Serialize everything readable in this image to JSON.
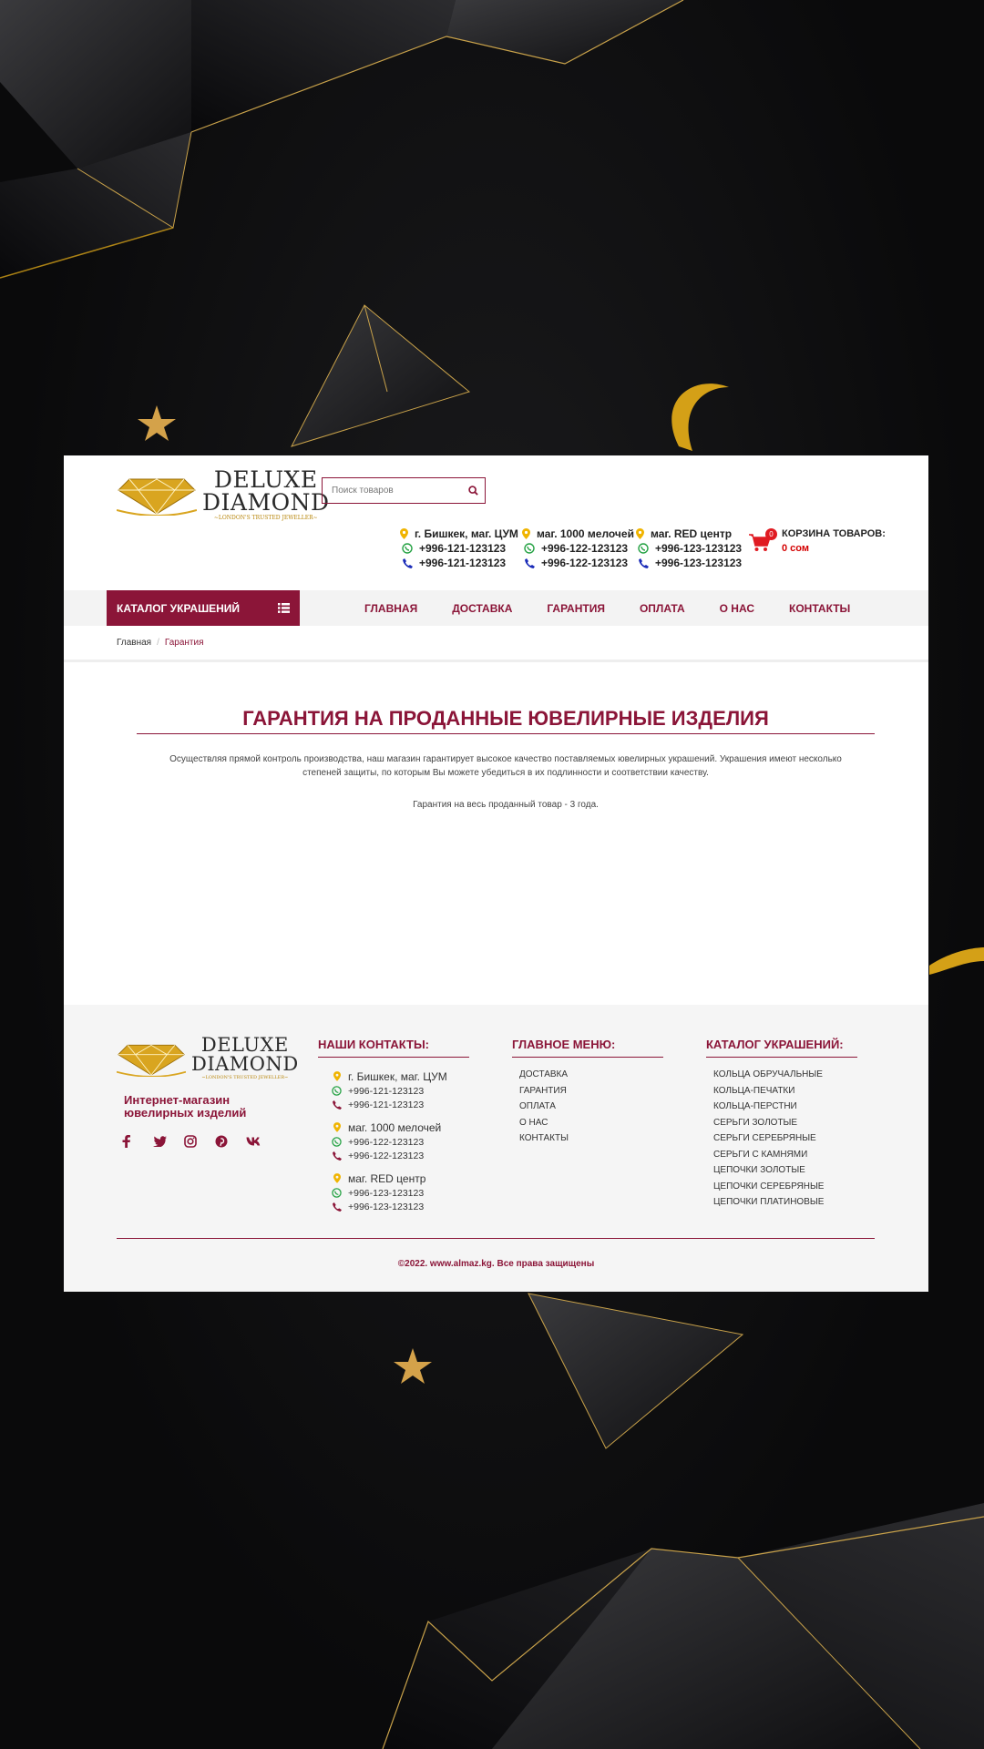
{
  "brand": {
    "name_line1": "DELUXE",
    "name_line2": "DIAMOND",
    "tagline": "~LONDON'S TRUSTED JEWELLER~",
    "gold": "#d4a017",
    "accent": "#8b1538"
  },
  "search": {
    "placeholder": "Поиск товаров",
    "icon": "search-icon"
  },
  "stores": [
    {
      "name": "г. Бишкек, маг. ЦУМ",
      "whatsapp": "+996-121-123123",
      "phone": "+996-121-123123"
    },
    {
      "name": "маг. 1000 мелочей",
      "whatsapp": "+996-122-123123",
      "phone": "+996-122-123123"
    },
    {
      "name": "маг. RED центр",
      "whatsapp": "+996-123-123123",
      "phone": "+996-123-123123"
    }
  ],
  "cart": {
    "count": "0",
    "title": "КОРЗИНА ТОВАРОВ:",
    "sum": "0 сом"
  },
  "nav": {
    "catalog_label": "КАТАЛОГ УКРАШЕНИЙ",
    "links": [
      "ГЛАВНАЯ",
      "ДОСТАВКА",
      "ГАРАНТИЯ",
      "ОПЛАТА",
      "О НАС",
      "КОНТАКТЫ"
    ]
  },
  "breadcrumb": {
    "home": "Главная",
    "current": "Гарантия"
  },
  "content": {
    "title": "ГАРАНТИЯ НА ПРОДАННЫЕ ЮВЕЛИРНЫЕ ИЗДЕЛИЯ",
    "intro": "Осуществляя прямой контроль производства, наш магазин гарантирует высокое качество поставляемых ювелирных украшений. Украшения имеют несколько степеней защиты, по которым Вы можете убедиться в их подлинности и соответствии качеству.",
    "guarantee": "Гарантия на весь проданный товар - 3 года."
  },
  "footer": {
    "tagline": "Интернет-магазин ювелирных изделий",
    "socials": [
      "facebook-icon",
      "twitter-icon",
      "instagram-icon",
      "pinterest-icon",
      "vk-icon"
    ],
    "contacts_title": "НАШИ КОНТАКТЫ:",
    "menu_title": "ГЛАВНОЕ МЕНЮ:",
    "menu": [
      "ДОСТАВКА",
      "ГАРАНТИЯ",
      "ОПЛАТА",
      "О НАС",
      "КОНТАКТЫ"
    ],
    "catalog_title": "КАТАЛОГ УКРАШЕНИЙ:",
    "catalog": [
      "КОЛЬЦА ОБРУЧАЛЬНЫЕ",
      "КОЛЬЦА-ПЕЧАТКИ",
      "КОЛЬЦА-ПЕРСТНИ",
      "СЕРЬГИ ЗОЛОТЫЕ",
      "СЕРЬГИ СЕРЕБРЯНЫЕ",
      "СЕРЬГИ С КАМНЯМИ",
      "ЦЕПОЧКИ ЗОЛОТЫЕ",
      "ЦЕПОЧКИ СЕРЕБРЯНЫЕ",
      "ЦЕПОЧКИ ПЛАТИНОВЫЕ"
    ],
    "copyright": "©2022. www.almaz.kg. Все права защищены"
  }
}
